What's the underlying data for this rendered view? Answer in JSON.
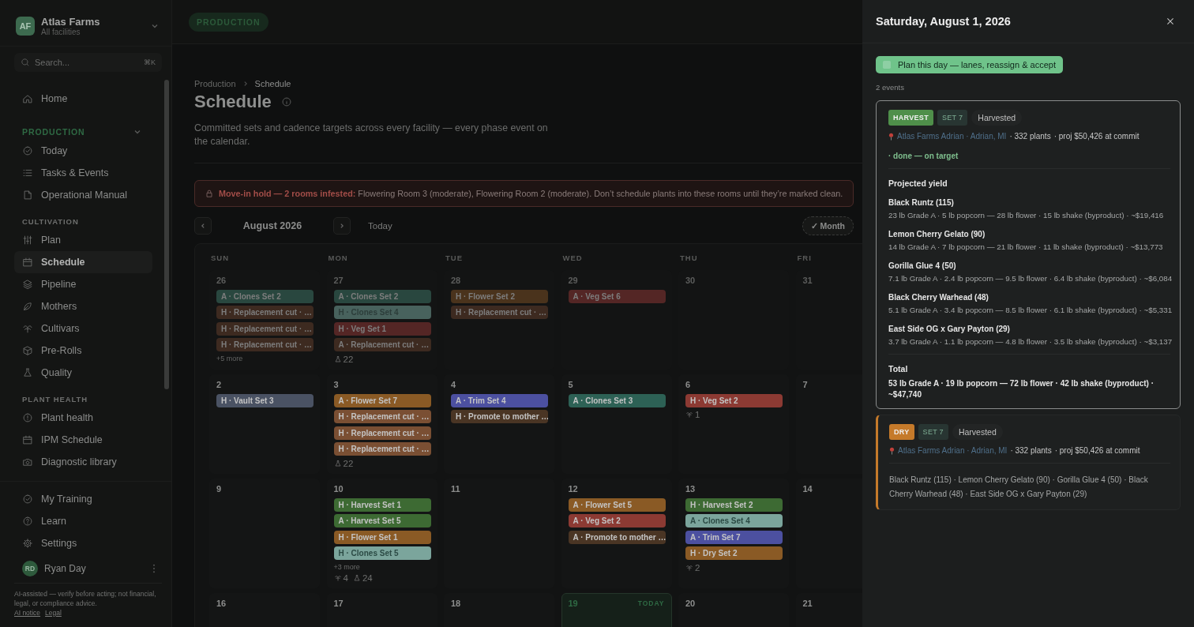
{
  "sidebar": {
    "org": {
      "initials": "AF",
      "name": "Atlas Farms",
      "subtitle": "All facilities"
    },
    "search": {
      "placeholder": "Search...",
      "shortcut": "⌘K"
    },
    "home": {
      "label": "Home",
      "selected": false
    },
    "sections": [
      {
        "title": "PRODUCTION",
        "kind": "collapsible",
        "expanded": true,
        "items": [
          {
            "label": "Today",
            "selected": false
          },
          {
            "label": "Tasks & Events",
            "selected": false
          },
          {
            "label": "Operational Manual",
            "selected": false
          }
        ]
      },
      {
        "title": "CULTIVATION",
        "kind": "plain",
        "items": [
          {
            "label": "Plan",
            "selected": false
          },
          {
            "label": "Schedule",
            "selected": true
          },
          {
            "label": "Pipeline",
            "selected": false
          },
          {
            "label": "Mothers",
            "selected": false
          },
          {
            "label": "Cultivars",
            "selected": false
          },
          {
            "label": "Pre-Rolls",
            "selected": false
          },
          {
            "label": "Quality",
            "selected": false
          }
        ]
      },
      {
        "title": "PLANT HEALTH",
        "kind": "plain",
        "items": [
          {
            "label": "Plant health",
            "selected": false
          },
          {
            "label": "IPM Schedule",
            "selected": false
          },
          {
            "label": "Diagnostic library",
            "selected": false
          }
        ]
      }
    ],
    "bottom": [
      {
        "label": "My Training",
        "selected": false
      },
      {
        "label": "Learn",
        "selected": false
      },
      {
        "label": "Settings",
        "selected": false
      }
    ],
    "user": {
      "initials": "RD",
      "name": "Ryan Day"
    },
    "disclaimer": {
      "text": "AI-assisted — verify before acting; not financial, legal, or compliance advice.",
      "links": [
        "AI notice",
        "Legal"
      ]
    }
  },
  "topbar": {
    "badge": "PRODUCTION"
  },
  "page": {
    "breadcrumb": [
      "Production",
      "Schedule"
    ],
    "title": "Schedule",
    "description": "Committed sets and cadence targets across every facility — every phase event on the calendar."
  },
  "alert": {
    "lead": "Move-in hold — 2 rooms infested:",
    "text": "Flowering Room 3 (moderate), Flowering Room 2 (moderate). Don’t schedule plants into these rooms until they’re marked clean."
  },
  "calendar": {
    "month": "August 2026",
    "today_button": "Today",
    "view_button": "✓ Month",
    "weekdays": [
      "SUN",
      "MON",
      "TUE",
      "WED",
      "THU",
      "FRI"
    ],
    "weeks": [
      [
        {
          "date": "26",
          "outside": true,
          "today": false,
          "events": [
            {
              "label": "A · Clones Set 2",
              "color": "#29473f"
            },
            {
              "label": "H · Replacement cut · …",
              "color": "#3d2a20"
            },
            {
              "label": "H · Replacement cut · …",
              "color": "#3d2a20"
            },
            {
              "label": "H · Replacement cut · …",
              "color": "#3d2a20"
            }
          ],
          "more": "+5 more"
        },
        {
          "date": "27",
          "outside": true,
          "today": false,
          "events": [
            {
              "label": "A · Clones Set 2",
              "color": "#29473f"
            },
            {
              "label": "H · Clones Set 4",
              "color": "#48625d"
            },
            {
              "label": "H · Veg Set 1",
              "color": "#542625"
            },
            {
              "label": "A · Replacement cut · …",
              "color": "#3d2a20"
            }
          ],
          "counts": [
            {
              "kind": "flask",
              "value": "22"
            }
          ]
        },
        {
          "date": "28",
          "outside": true,
          "today": false,
          "events": [
            {
              "label": "H · Flower Set 2",
              "color": "#4a331c"
            },
            {
              "label": "H · Replacement cut · …",
              "color": "#3d2a20"
            }
          ]
        },
        {
          "date": "29",
          "outside": true,
          "today": false,
          "events": [
            {
              "label": "A · Veg Set 6",
              "color": "#542625"
            }
          ]
        },
        {
          "date": "30",
          "outside": true,
          "today": false
        },
        {
          "date": "31",
          "outside": true,
          "today": false
        }
      ],
      [
        {
          "date": "2",
          "outside": false,
          "today": false,
          "events": [
            {
              "label": "H · Vault Set 3",
              "color": "#4a5263"
            }
          ]
        },
        {
          "date": "3",
          "outside": false,
          "today": false,
          "events": [
            {
              "label": "A · Flower Set 7",
              "color": "#8a5a25"
            },
            {
              "label": "H · Replacement cut · …",
              "color": "#7a4f33"
            },
            {
              "label": "H · Replacement cut · …",
              "color": "#7a4f33"
            },
            {
              "label": "H · Replacement cut · …",
              "color": "#7a4f33"
            }
          ],
          "counts": [
            {
              "kind": "flask",
              "value": "22"
            }
          ]
        },
        {
          "date": "4",
          "outside": false,
          "today": false,
          "events": [
            {
              "label": "A · Trim Set 4",
              "color": "#4c50a0"
            },
            {
              "label": "H · Promote to mother …",
              "color": "#4a3524"
            }
          ]
        },
        {
          "date": "5",
          "outside": false,
          "today": false,
          "events": [
            {
              "label": "A · Clones Set 3",
              "color": "#2d6155"
            }
          ]
        },
        {
          "date": "6",
          "outside": false,
          "today": false,
          "events": [
            {
              "label": "H · Veg Set 2",
              "color": "#8c3a33"
            }
          ],
          "counts": [
            {
              "kind": "plant",
              "value": "1"
            }
          ]
        },
        {
          "date": "7",
          "outside": false,
          "today": false
        }
      ],
      [
        {
          "date": "9",
          "outside": false,
          "today": false
        },
        {
          "date": "10",
          "outside": false,
          "today": false,
          "events": [
            {
              "label": "H · Harvest Set 1",
              "color": "#3d6a33"
            },
            {
              "label": "A · Harvest Set 5",
              "color": "#3d6a33"
            },
            {
              "label": "H · Flower Set 1",
              "color": "#8a5a25"
            },
            {
              "label": "H · Clones Set 5",
              "color": "#7ba59c"
            }
          ],
          "more": "+3 more",
          "counts": [
            {
              "kind": "plant",
              "value": "4"
            },
            {
              "kind": "flask",
              "value": "24"
            }
          ]
        },
        {
          "date": "11",
          "outside": false,
          "today": false
        },
        {
          "date": "12",
          "outside": false,
          "today": false,
          "events": [
            {
              "label": "A · Flower Set 5",
              "color": "#8a5a25"
            },
            {
              "label": "A · Veg Set 2",
              "color": "#8c3a33"
            },
            {
              "label": "A · Promote to mother …",
              "color": "#4a3524"
            }
          ]
        },
        {
          "date": "13",
          "outside": false,
          "today": false,
          "events": [
            {
              "label": "H · Harvest Set 2",
              "color": "#3d6a33"
            },
            {
              "label": "A · Clones Set 4",
              "color": "#7ba59c"
            },
            {
              "label": "A · Trim Set 7",
              "color": "#4c50a0"
            },
            {
              "label": "H · Dry Set 2",
              "color": "#8a5a25"
            }
          ],
          "counts": [
            {
              "kind": "plant",
              "value": "2"
            }
          ]
        },
        {
          "date": "14",
          "outside": false,
          "today": false
        }
      ],
      [
        {
          "date": "16",
          "outside": false,
          "today": false
        },
        {
          "date": "17",
          "outside": false,
          "today": false
        },
        {
          "date": "18",
          "outside": false,
          "today": false
        },
        {
          "date": "19",
          "outside": false,
          "today": true,
          "today_label": "TODAY"
        },
        {
          "date": "20",
          "outside": false,
          "today": false
        },
        {
          "date": "21",
          "outside": false,
          "today": false
        }
      ]
    ]
  },
  "drawer": {
    "title": "Saturday, August 1, 2026",
    "plan_button": "Plan this day — lanes, reassign & accept",
    "count": "2 events",
    "events": [
      {
        "kind": "harvest",
        "selected": true,
        "color": "#4f8f4a",
        "badge": "HARVEST",
        "set": "SET 7",
        "status": "Harvested",
        "location": "Atlas Farms Adrian · Adrian, MI",
        "plants": "· 332 plants",
        "projection": "· proj $50,426 at commit",
        "outcome": "· done — on target",
        "yield_title": "Projected yield",
        "yields": [
          {
            "name": "Black Runtz (115)",
            "detail": "23 lb Grade A · 5 lb popcorn — 28 lb flower · 15 lb shake (byproduct) · ~$19,416"
          },
          {
            "name": "Lemon Cherry Gelato (90)",
            "detail": "14 lb Grade A · 7 lb popcorn — 21 lb flower · 11 lb shake (byproduct) · ~$13,773"
          },
          {
            "name": "Gorilla Glue 4 (50)",
            "detail": "7.1 lb Grade A · 2.4 lb popcorn — 9.5 lb flower · 6.4 lb shake (byproduct) · ~$6,084"
          },
          {
            "name": "Black Cherry Warhead (48)",
            "detail": "5.1 lb Grade A · 3.4 lb popcorn — 8.5 lb flower · 6.1 lb shake (byproduct) · ~$5,331"
          },
          {
            "name": "East Side OG x Gary Payton (29)",
            "detail": "3.7 lb Grade A · 1.1 lb popcorn — 4.8 lb flower · 3.5 lb shake (byproduct) · ~$3,137"
          }
        ],
        "total_label": "Total",
        "total": "53 lb Grade A · 19 lb popcorn — 72 lb flower · 42 lb shake (byproduct) · ~$47,740"
      },
      {
        "kind": "dry",
        "selected": false,
        "color": "#c57a2a",
        "badge": "DRY",
        "set": "SET 7",
        "status": "Harvested",
        "location": "Atlas Farms Adrian · Adrian, MI",
        "plants": "· 332 plants",
        "projection": "· proj $50,426 at commit",
        "strains": "Black Runtz (115) · Lemon Cherry Gelato (90) · Gorilla Glue 4 (50) · Black Cherry Warhead (48) · East Side OG x Gary Payton (29)"
      }
    ]
  }
}
